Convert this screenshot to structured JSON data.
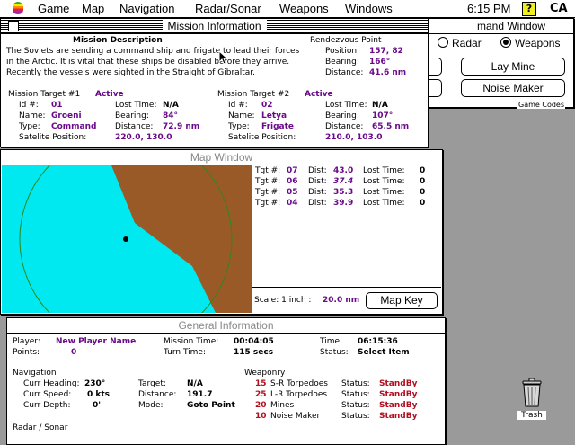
{
  "menu": {
    "items": [
      "Game",
      "Map",
      "Navigation",
      "Radar/Sonar",
      "Weapons",
      "Windows"
    ],
    "clock": "6:15 PM",
    "help_icon": "?",
    "app_icon": "CA"
  },
  "command_window": {
    "title": "Command Window",
    "title_visible": "mand Window",
    "radio_radar": "Radar",
    "radio_weapons": "Weapons",
    "selected": "Weapons",
    "lay_mine": "Lay Mine",
    "noise_maker": "Noise Maker",
    "game_codes": "Game Codes"
  },
  "mission": {
    "title": "Mission Information",
    "desc_heading": "Mission Description",
    "desc_lines": [
      "The Soviets are sending a command ship and frigate to lead their forces",
      "in the Arctic. It is vital that these ships be disabled before they arrive.",
      "Recently the vessels were sighted in the Straight of Gibraltar."
    ],
    "rendezvous": {
      "heading": "Rendezvous Point",
      "position_label": "Position:",
      "position": "157, 82",
      "bearing_label": "Bearing:",
      "bearing": "166°",
      "distance_label": "Distance:",
      "distance": "41.6 nm"
    },
    "targets": [
      {
        "heading": "Mission Target #1",
        "status": "Active",
        "id": "01",
        "name": "Groeni",
        "type": "Command",
        "lost_time": "N/A",
        "bearing": "84°",
        "distance": "72.9 nm",
        "satellite": "220.0, 130.0"
      },
      {
        "heading": "Mission Target #2",
        "status": "Active",
        "id": "02",
        "name": "Letya",
        "type": "Frigate",
        "lost_time": "N/A",
        "bearing": "107°",
        "distance": "65.5 nm",
        "satellite": "210.0, 103.0"
      }
    ],
    "labels": {
      "id": "Id #:",
      "name": "Name:",
      "type": "Type:",
      "lost_time": "Lost Time:",
      "bearing": "Bearing:",
      "distance": "Distance:",
      "satellite": "Satelite Position:"
    }
  },
  "map_window": {
    "title": "Map Window",
    "targets": [
      {
        "tgt_label": "Tgt #:",
        "tgt": "07",
        "dist_label": "Dist:",
        "dist": "43.0",
        "lost_label": "Lost Time:",
        "lost": "0"
      },
      {
        "tgt_label": "Tgt #:",
        "tgt": "06",
        "dist_label": "Dist:",
        "dist": "37.4",
        "lost_label": "Lost Time:",
        "lost": "0"
      },
      {
        "tgt_label": "Tgt #:",
        "tgt": "05",
        "dist_label": "Dist:",
        "dist": "35.3",
        "lost_label": "Lost Time:",
        "lost": "0"
      },
      {
        "tgt_label": "Tgt #:",
        "tgt": "04",
        "dist_label": "Dist:",
        "dist": "39.9",
        "lost_label": "Lost Time:",
        "lost": "0"
      }
    ],
    "scale_label": "Scale: 1 inch :",
    "scale_value": "20.0 nm",
    "map_key": "Map Key",
    "colors": {
      "sea": "#00e8f0",
      "land": "#9a5a28",
      "range_ring": "#2a8a18"
    }
  },
  "general": {
    "title": "General Information",
    "player_label": "Player:",
    "player": "New Player Name",
    "points_label": "Points:",
    "points": "0",
    "mission_time_label": "Mission Time:",
    "mission_time": "00:04:05",
    "turn_time_label": "Turn Time:",
    "turn_time": "115 secs",
    "time_label": "Time:",
    "time": "06:15:36",
    "status_label": "Status:",
    "status": "Select Item",
    "navigation_heading": "Navigation",
    "heading_label": "Curr Heading:",
    "heading": "230°",
    "speed_label": "Curr Speed:",
    "speed": "0 kts",
    "depth_label": "Curr Depth:",
    "depth": "0'",
    "target_label": "Target:",
    "target": "N/A",
    "distance_label": "Distance:",
    "distance": "191.7",
    "mode_label": "Mode:",
    "mode": "Goto Point",
    "weaponry_heading": "Weaponry",
    "weapons": [
      {
        "count": "15",
        "name": "S-R Torpedoes",
        "status_label": "Status:",
        "status": "StandBy"
      },
      {
        "count": "25",
        "name": "L-R Torpedoes",
        "status_label": "Status:",
        "status": "StandBy"
      },
      {
        "count": "20",
        "name": "Mines",
        "status_label": "Status:",
        "status": "StandBy"
      },
      {
        "count": "10",
        "name": "Noise Maker",
        "status_label": "Status:",
        "status": "StandBy"
      }
    ],
    "radar_sonar_heading": "Radar / Sonar"
  },
  "desktop": {
    "trash_label": "Trash"
  }
}
